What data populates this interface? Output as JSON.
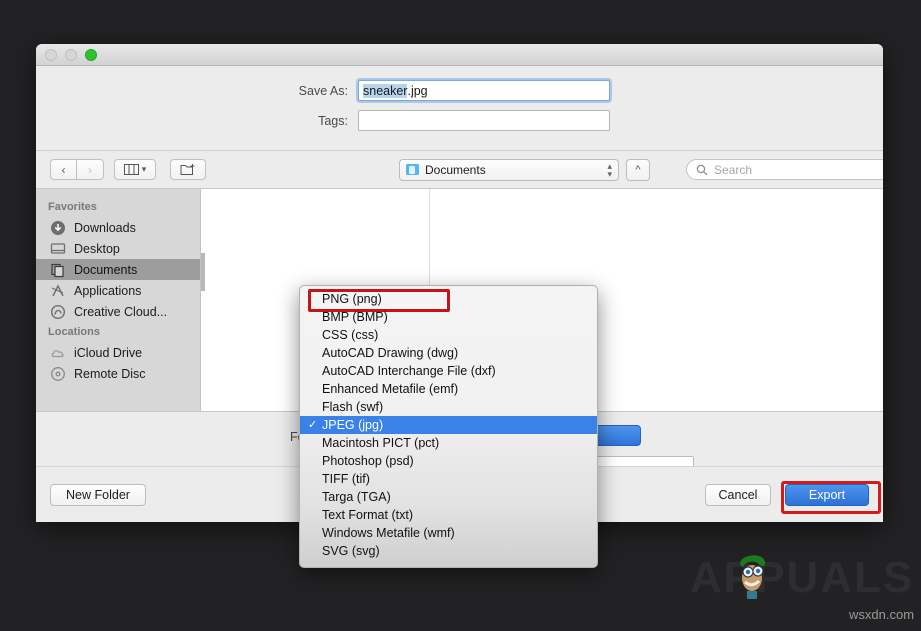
{
  "window": {
    "traffic_lights": [
      "close",
      "minimize",
      "zoom"
    ]
  },
  "form": {
    "save_as_label": "Save As:",
    "save_as_value_selected": "sneaker",
    "save_as_value_rest": ".jpg",
    "tags_label": "Tags:",
    "tags_value": ""
  },
  "toolbar": {
    "back_icon": "chevron-left",
    "forward_icon": "chevron-right",
    "view_icon": "column-view",
    "new_folder_icon": "new-folder",
    "path_popup_value": "Documents",
    "up_button_icon": "chevron-up",
    "search_placeholder": "Search",
    "search_value": ""
  },
  "sidebar": {
    "sections": [
      {
        "header": "Favorites",
        "items": [
          {
            "label": "Downloads",
            "icon": "downloads-icon",
            "active": false
          },
          {
            "label": "Desktop",
            "icon": "desktop-icon",
            "active": false
          },
          {
            "label": "Documents",
            "icon": "documents-icon",
            "active": true
          },
          {
            "label": "Applications",
            "icon": "applications-icon",
            "active": false
          },
          {
            "label": "Creative Cloud...",
            "icon": "creative-cloud-icon",
            "active": false
          }
        ]
      },
      {
        "header": "Locations",
        "items": [
          {
            "label": "iCloud Drive",
            "icon": "icloud-icon",
            "active": false
          },
          {
            "label": "Remote Disc",
            "icon": "disc-icon",
            "active": false
          }
        ]
      }
    ]
  },
  "format_panel": {
    "label": "Format",
    "selected_value": "JPEG (jpg)"
  },
  "footer": {
    "new_folder_label": "New Folder",
    "cancel_label": "Cancel",
    "export_label": "Export"
  },
  "format_menu": {
    "items": [
      {
        "label": "PNG (png)",
        "checked": false,
        "highlighted": true
      },
      {
        "label": "BMP (BMP)",
        "checked": false,
        "highlighted": false
      },
      {
        "label": "CSS (css)",
        "checked": false,
        "highlighted": false
      },
      {
        "label": "AutoCAD Drawing (dwg)",
        "checked": false,
        "highlighted": false
      },
      {
        "label": "AutoCAD Interchange File (dxf)",
        "checked": false,
        "highlighted": false
      },
      {
        "label": "Enhanced Metafile (emf)",
        "checked": false,
        "highlighted": false
      },
      {
        "label": "Flash (swf)",
        "checked": false,
        "highlighted": false
      },
      {
        "label": "JPEG (jpg)",
        "checked": true,
        "highlighted": false
      },
      {
        "label": "Macintosh PICT (pct)",
        "checked": false,
        "highlighted": false
      },
      {
        "label": "Photoshop (psd)",
        "checked": false,
        "highlighted": false
      },
      {
        "label": "TIFF (tif)",
        "checked": false,
        "highlighted": false
      },
      {
        "label": "Targa (TGA)",
        "checked": false,
        "highlighted": false
      },
      {
        "label": "Text Format (txt)",
        "checked": false,
        "highlighted": false
      },
      {
        "label": "Windows Metafile (wmf)",
        "checked": false,
        "highlighted": false
      },
      {
        "label": "SVG (svg)",
        "checked": false,
        "highlighted": false
      }
    ],
    "checkmark_glyph": "✓"
  },
  "annotations": {
    "highlight_color": "#c41414",
    "export_highlight_color": "#d61a1a"
  },
  "watermark": {
    "brand": "APPUALS",
    "url": "wsxdn.com"
  },
  "colors": {
    "accent_blue": "#3b82e8",
    "selection_blue": "#b7d3f0",
    "desktop": "#222224"
  }
}
